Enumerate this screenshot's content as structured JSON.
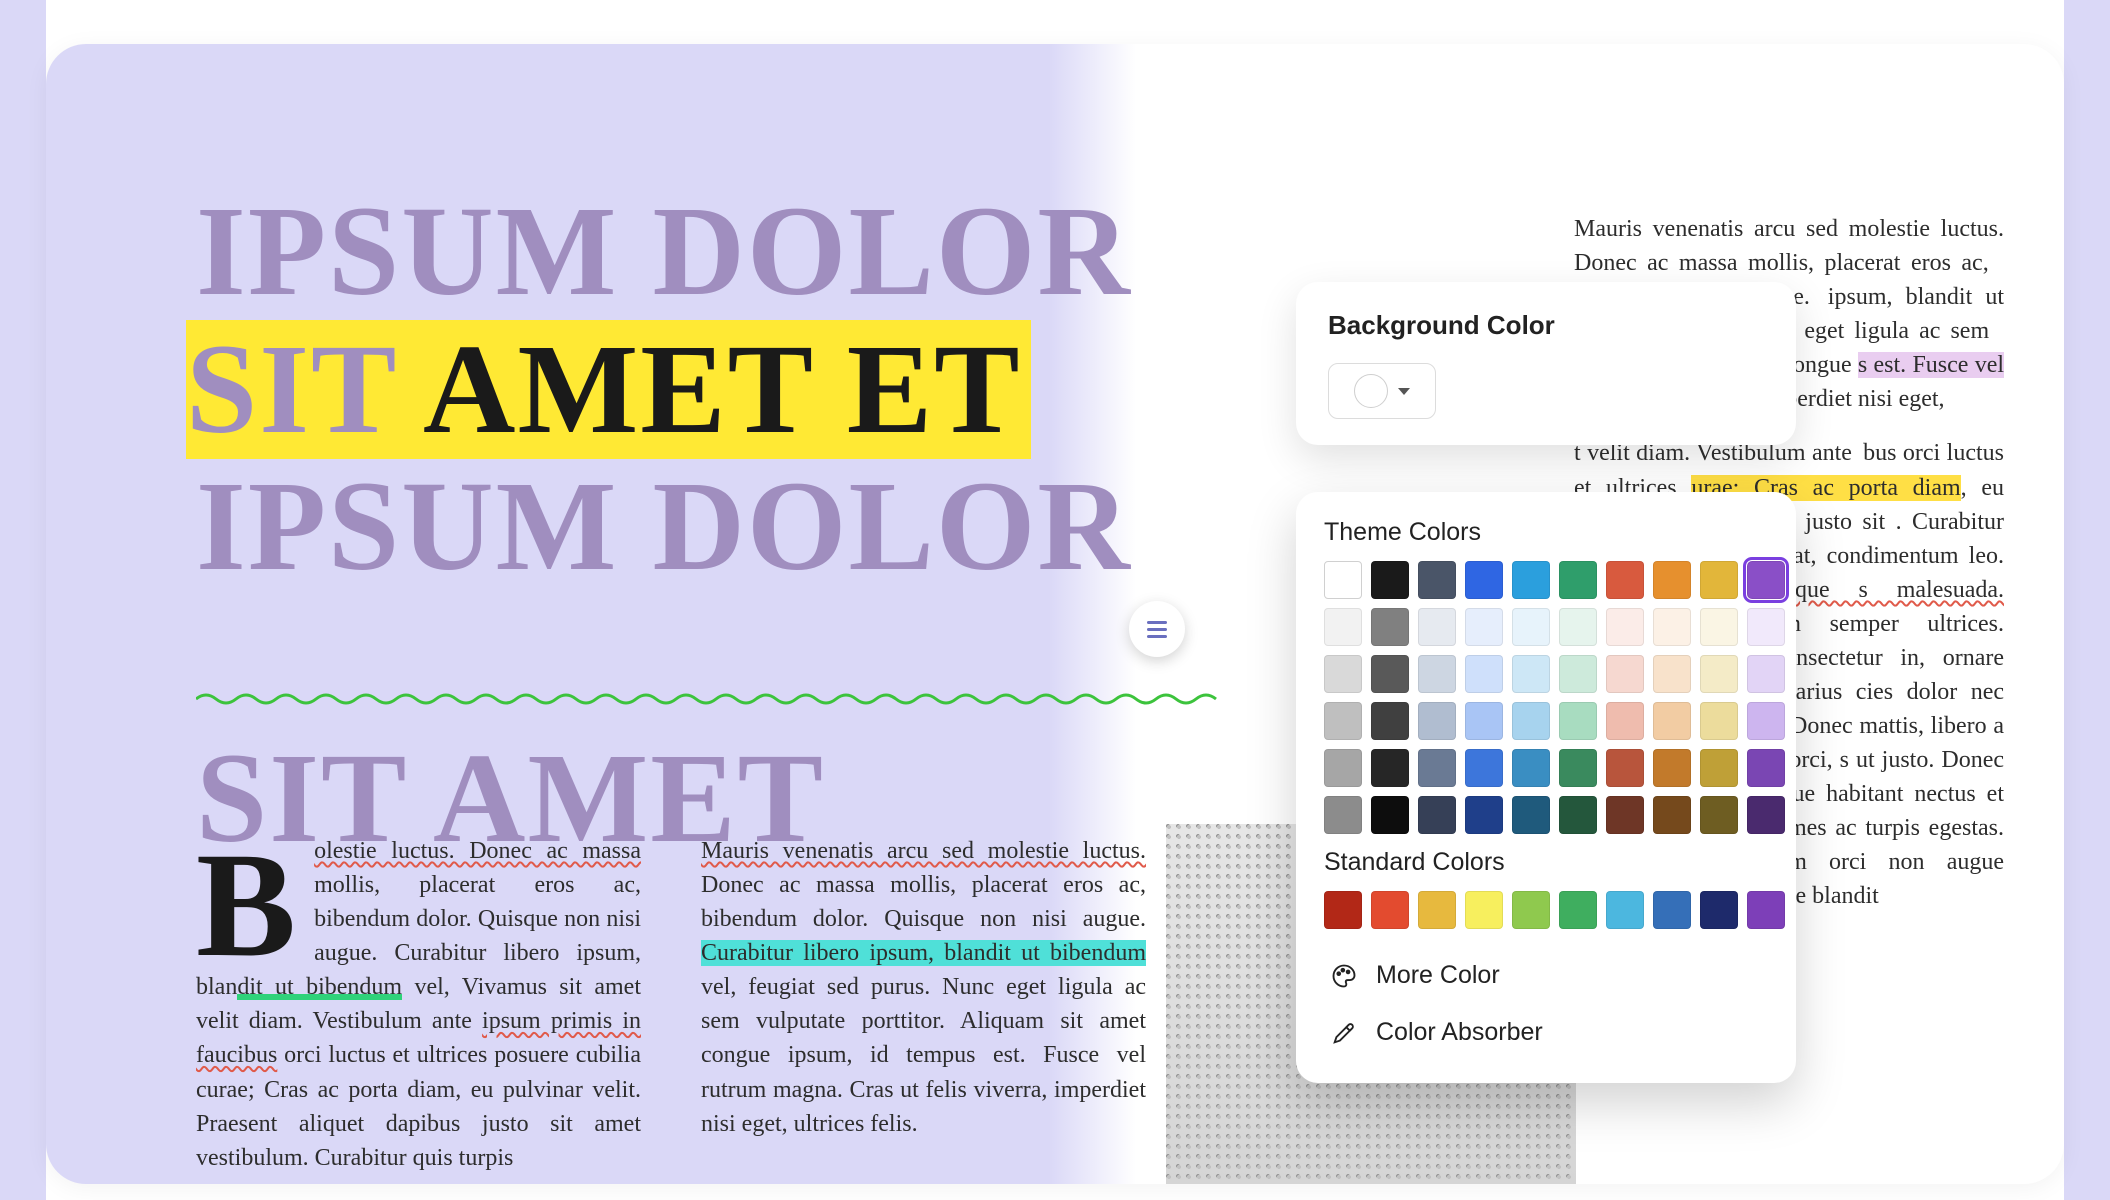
{
  "title": {
    "line1": "IPSUM DOLOR",
    "line2_purple": "SIT ",
    "line2_black": "AMET ET",
    "line3": "IPSUM DOLOR",
    "line4": "SIT AMET"
  },
  "body_left_col1": {
    "dropcap": "B",
    "seg1": "olestie luctus. Donec ac massa",
    "seg2": " mollis, placerat eros ac, bibendum dolor. Quisque non nisi augue. Curabitur libero ipsum, blan",
    "seg3_green": "dit ut  bibendum",
    "seg4": " vel, Vivamus sit amet velit diam. Vestibulum ante ",
    "seg5_red": "ipsum primis in faucibus",
    "seg6": "  orci luctus et ultrices posuere cubilia curae; Cras ac porta diam, eu pulvinar velit. Praesent aliquet dapibus justo sit amet vestibulum.  Curabitur quis turpis"
  },
  "body_left_col2": {
    "seg1": "Mauris venenatis  arcu sed molestie luctus.",
    "seg2": " Donec ac massa mollis, placerat eros ac, bibendum dolor. Quisque non nisi augue. ",
    "seg3_cyan": "Curabitur libero ipsum, blandit ut  bibendum",
    "seg4": " vel, feugiat sed purus. Nunc eget ligula ac sem vulputate  porttitor. Aliquam sit amet congue ipsum, id tempus est. Fusce vel  rutrum magna. Cras ut felis viverra, imperdiet nisi eget, ultrices  felis."
  },
  "body_right": {
    "p1a": "Mauris venenatis  arcu sed molestie luctus. Donec ac massa mollis, placerat eros ac,  uisque non nisi augue.  ipsum, blandit ut  bibendum  urus. Nunc eget ligula ac sem  tor. Aliquam sit amet congue ",
    "p1b_pink": "s est. Fusce vel  rutrum magna.",
    "p1c": " rra, imperdiet nisi eget,",
    "p2a": "t velit diam. Vestibulum ante  bus  orci luctus et ultrices ",
    "p2b_yellow": "urae; Cras ac porta diam",
    "p2c": ", eu aesent aliquet dapibus justo sit .  Curabitur quis turpis ltrices mi at, condimentum leo. ltrices quam. ",
    "p2d_red": "Quisque s malesuada.  Suspendisse",
    "p2e": "  s sem semper ultrices. Vivamus derit at consectetur in, ornare ndimentum urna et  varius cies dolor nec felis ornare, id enatis. Donec mattis, libero a t, libero lacus  egestas orci, s ut justo. Donec tempus da. Pellentesque habitant nectus et netus et  malesuada fames ac turpis egestas. Suspendisse dignissim orci non augue  efficitur luctus. Quisque blandit"
  },
  "bg_panel": {
    "title": "Background Color"
  },
  "picker": {
    "theme_label": "Theme Colors",
    "standard_label": "Standard Colors",
    "more_label": "More Color",
    "absorber_label": "Color Absorber",
    "theme_grid": [
      [
        "#ffffff",
        "#1a1a1a",
        "#4a5568",
        "#2f66e3",
        "#2b9fdd",
        "#2f9e6b",
        "#d85a3e",
        "#e6902e",
        "#e2b63a",
        "#8a4fc7"
      ],
      [
        "#f2f2f2",
        "#808080",
        "#e6eaf0",
        "#e6eefc",
        "#e7f3fb",
        "#e6f4ed",
        "#fbece8",
        "#fcf1e6",
        "#faf5e4",
        "#f1e9fb"
      ],
      [
        "#d9d9d9",
        "#595959",
        "#cdd6e2",
        "#cfe0fb",
        "#cde7f6",
        "#cdeadb",
        "#f6d8d0",
        "#f8e2cb",
        "#f4ebc7",
        "#e2d4f6"
      ],
      [
        "#bfbfbf",
        "#404040",
        "#b0bdd0",
        "#a9c5f5",
        "#a7d3ee",
        "#a8dcc0",
        "#efbcae",
        "#f2cca3",
        "#ecdc9c",
        "#cdb5ef"
      ],
      [
        "#a6a6a6",
        "#262626",
        "#6a7a94",
        "#3d76db",
        "#3a8ec2",
        "#3a8a5e",
        "#b8553c",
        "#c27a2b",
        "#bfa037",
        "#7a46b3"
      ],
      [
        "#8c8c8c",
        "#0d0d0d",
        "#364057",
        "#1f3f8a",
        "#1f5a7c",
        "#24573c",
        "#6e3626",
        "#75491c",
        "#6e5d22",
        "#4a2a6e"
      ]
    ],
    "selected": [
      0,
      9
    ],
    "standard_row": [
      "#b22817",
      "#e34b2f",
      "#e7b93e",
      "#f7ef5e",
      "#8fc94e",
      "#3fae5f",
      "#4cb7df",
      "#356fb8",
      "#1e2a6b",
      "#7d3fb8"
    ]
  }
}
